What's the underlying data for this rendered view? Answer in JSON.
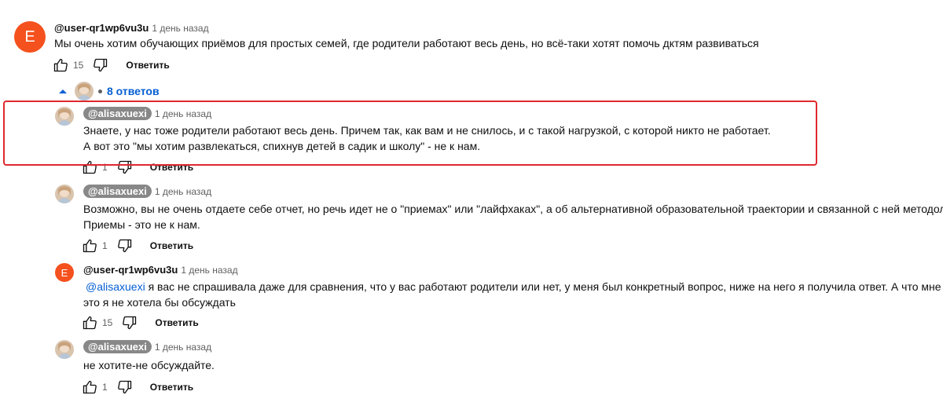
{
  "top_comment": {
    "avatar_letter": "E",
    "author": "@user-qr1wp6vu3u",
    "time": "1 день назад",
    "text": "Мы очень хотим обучающих приёмов для простых семей, где родители работают весь день,  но всё-таки хотят помочь дктям развиваться",
    "likes": "15",
    "reply_label": "Ответить"
  },
  "replies_toggle": {
    "label": "8 ответов"
  },
  "replies": [
    {
      "author": "@alisaxuexi",
      "time": "1 день назад",
      "lines": [
        "Знаете, у нас тоже родители работают весь день.  Причем так, как вам и не снилось, и с такой нагрузкой, с которой никто не работает.",
        "А вот это \"мы хотим развлекаться, спихнув детей в садик и школу\"  - не к нам."
      ],
      "likes": "1",
      "reply_label": "Ответить"
    },
    {
      "author": "@alisaxuexi",
      "time": "1 день назад",
      "lines": [
        "Возможно, вы не очень отдаете себе отчет, но речь идет не о \"приемах\" или \"лайфхаках\", а об альтернативной образовательной траектории и связанной с ней методологии.",
        "Приемы - это не к нам."
      ],
      "likes": "1",
      "reply_label": "Ответить"
    },
    {
      "avatar_letter": "E",
      "author": "@user-qr1wp6vu3u",
      "time": "1 день назад",
      "mention": "@alisaxuexi",
      "lines": [
        "  я вас не спрашивала даже для сравнения,  что у вас работают родители или нет, у меня был конкретный вопрос,  ниже на него я получила ответ. А что мне снится-",
        "это я не хотела бы обсуждать"
      ],
      "likes": "15",
      "reply_label": "Ответить"
    },
    {
      "author": "@alisaxuexi",
      "time": "1 день назад",
      "lines": [
        "не хотите-не обсуждайте."
      ],
      "likes": "1",
      "reply_label": "Ответить"
    }
  ],
  "colors": {
    "accent": "#065fd4",
    "avatar_e": "#f4511e",
    "highlight": "#e0282e"
  },
  "icons": [
    "like-icon",
    "dislike-icon",
    "caret-up-icon"
  ]
}
